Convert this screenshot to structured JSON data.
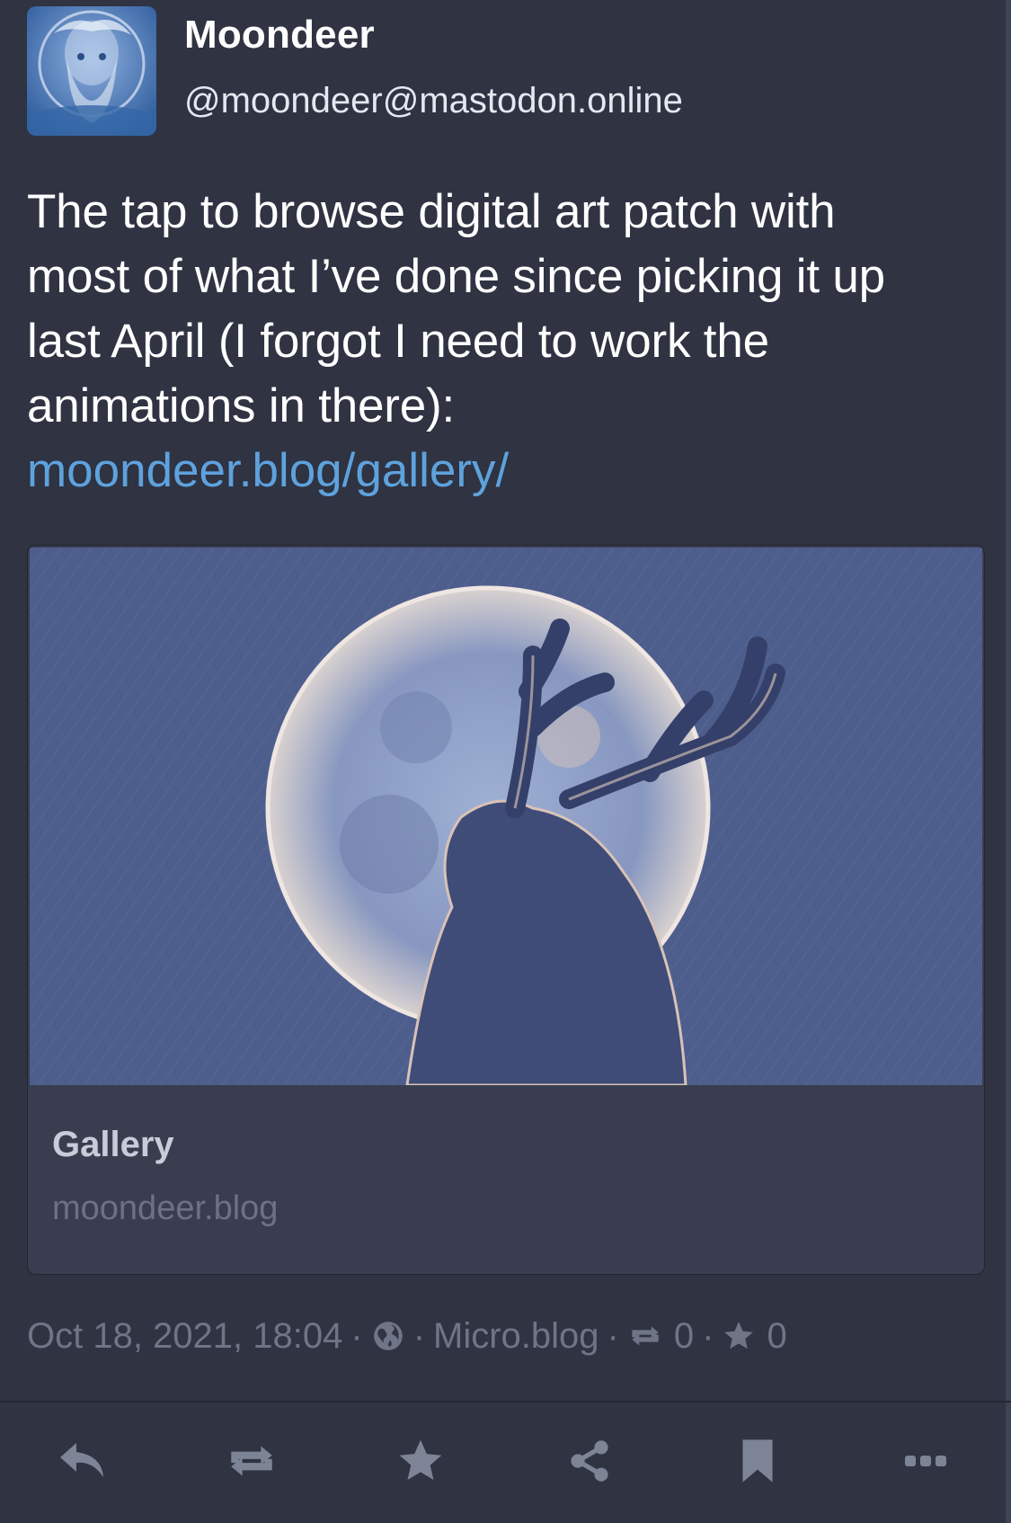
{
  "author": {
    "display_name": "Moondeer",
    "handle": "@moondeer@mastodon.online",
    "avatar_icon": "avatar-portrait-icon"
  },
  "post": {
    "text_lines": [
      "The tap to browse digital art patch with",
      "most of what I’ve done since picking it up",
      "last April (I forgot I need to work the",
      "animations in there):"
    ],
    "link": "moondeer.blog/gallery/"
  },
  "card": {
    "title": "Gallery",
    "host": "moondeer.blog",
    "image_icon": "deer-moon-artwork"
  },
  "meta": {
    "date": "Oct 18, 2021, 18:04",
    "sep": "·",
    "visibility_icon": "globe-icon",
    "client": "Micro.blog",
    "boost_count": "0",
    "favourite_count": "0"
  },
  "actions": [
    {
      "name": "reply",
      "icon": "reply-icon"
    },
    {
      "name": "boost",
      "icon": "boost-icon"
    },
    {
      "name": "favourite",
      "icon": "star-icon"
    },
    {
      "name": "share",
      "icon": "share-icon"
    },
    {
      "name": "bookmark",
      "icon": "bookmark-icon"
    },
    {
      "name": "more",
      "icon": "more-icon"
    }
  ],
  "colors": {
    "background": "#2f3342",
    "card": "#393d4f",
    "link": "#5ea2dd",
    "muted": "#6f7587",
    "action_icon": "#7d8496"
  }
}
